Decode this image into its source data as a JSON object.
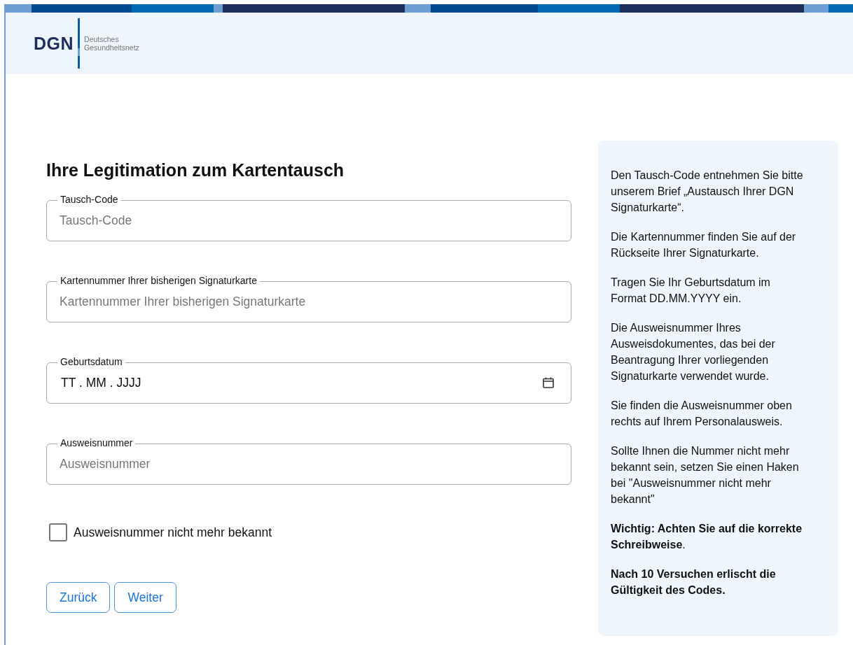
{
  "header": {
    "logo_mark": "DGN",
    "logo_text": [
      "Deutsches",
      "Gesundheitsnetz"
    ]
  },
  "form": {
    "title": "Ihre Legitimation zum Kartentausch",
    "fields": [
      {
        "kind": "text",
        "label": "Tausch-Code",
        "placeholder": "Tausch-Code"
      },
      {
        "kind": "text",
        "label": "Kartennummer Ihrer bisherigen Signaturkarte",
        "placeholder": "Kartennummer Ihrer bisherigen Signaturkarte"
      },
      {
        "kind": "date",
        "label": "Geburtsdatum",
        "value": "TT . MM . JJJJ"
      },
      {
        "kind": "text",
        "label": "Ausweisnummer",
        "placeholder": "Ausweisnummer"
      }
    ],
    "checkbox": {
      "label": "Ausweisnummer nicht mehr bekannt",
      "checked": false
    },
    "buttons": [
      "Zurück",
      "Weiter"
    ]
  },
  "info": [
    {
      "text": "Den Tausch-Code entnehmen Sie bitte unserem Brief „Austausch Ihrer DGN Signaturkarte“.",
      "strong": false
    },
    {
      "text": "Die Kartennummer finden Sie auf der Rückseite Ihrer Signaturkarte.",
      "strong": false
    },
    {
      "text": "Tragen Sie Ihr Geburtsdatum im Format DD.MM.YYYY ein.",
      "strong": false
    },
    {
      "text": "Die Ausweisnummer Ihres Ausweisdokumentes, das bei der Beantragung Ihrer vorliegenden Signaturkarte verwendet wurde.",
      "strong": false
    },
    {
      "text": "Sie finden die Ausweisnummer oben rechts auf Ihrem Personalausweis.",
      "strong": false
    },
    {
      "text": "Sollte Ihnen die Nummer nicht mehr bekannt sein, setzen Sie einen Haken bei \"Ausweisnummer nicht mehr bekannt\"",
      "strong": false
    },
    {
      "text": "**Wichtig: Achten Sie auf die korrekte Schreibweise**.",
      "strong": false
    },
    {
      "text": "Nach 10 Versuchen erlischt die Gültigkeit des Codes.",
      "strong": true
    }
  ]
}
